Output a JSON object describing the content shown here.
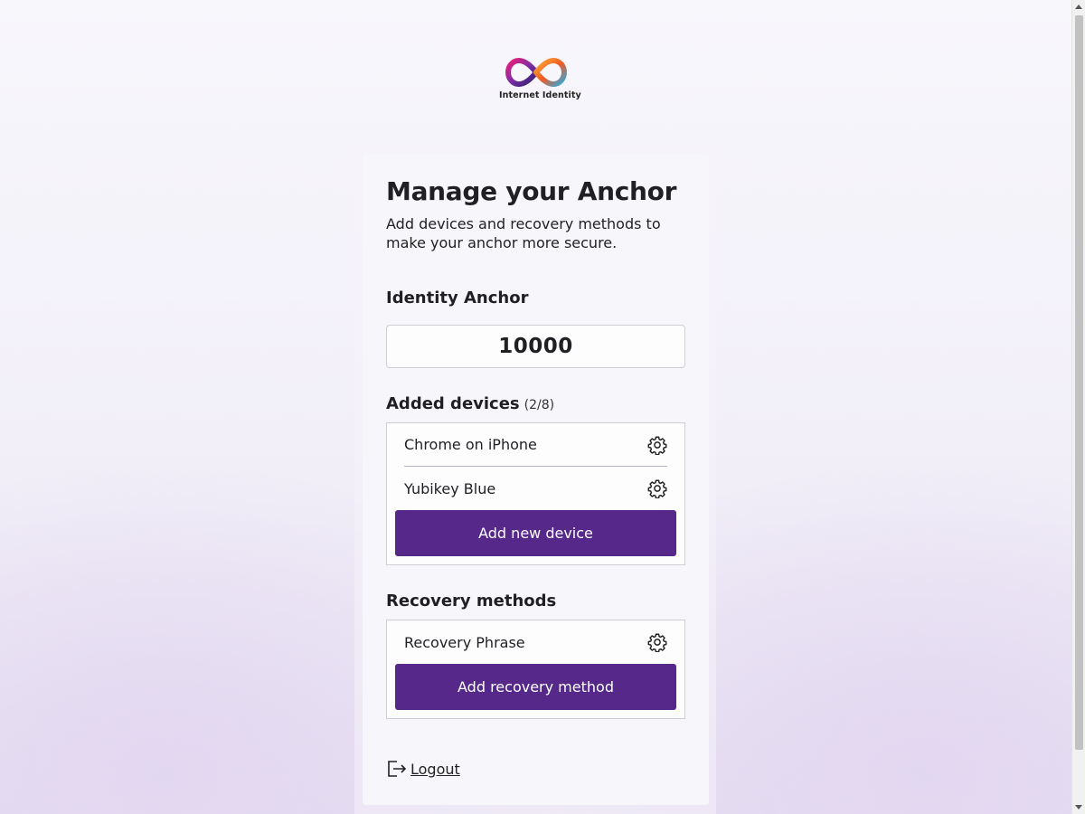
{
  "logo": {
    "text": "Internet Identity",
    "icon": "infinity-logo-icon"
  },
  "page": {
    "title": "Manage your Anchor",
    "subtitle": "Add devices and recovery methods to make your anchor more secure."
  },
  "anchor": {
    "label": "Identity Anchor",
    "value": "10000"
  },
  "devices": {
    "label": "Added devices",
    "count": "(2/8)",
    "items": [
      {
        "name": "Chrome on iPhone",
        "icon": "gear-icon"
      },
      {
        "name": "Yubikey Blue",
        "icon": "gear-icon"
      }
    ],
    "add_label": "Add new device"
  },
  "recovery": {
    "label": "Recovery methods",
    "items": [
      {
        "name": "Recovery Phrase",
        "icon": "gear-icon"
      }
    ],
    "add_label": "Add recovery method"
  },
  "logout": {
    "label": "Logout",
    "icon": "logout-icon"
  },
  "colors": {
    "primary": "#55288a",
    "text": "#1f1f24",
    "border": "#cfcdd6"
  }
}
